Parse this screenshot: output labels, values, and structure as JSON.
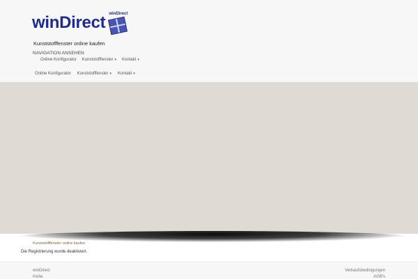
{
  "header": {
    "logo_text": "winDirect",
    "logo_badge_text": "winDirect",
    "tagline": "Kunststofffenster online kaufen",
    "nav_toggle": "NAVIGATION ANSEHEN"
  },
  "nav_primary": [
    {
      "label": "Online Konfigurator",
      "has_dropdown": false
    },
    {
      "label": "Kunststofffenster",
      "has_dropdown": true
    },
    {
      "label": "Kontakt",
      "has_dropdown": true
    }
  ],
  "nav_secondary": [
    {
      "label": "Online Konfigurator",
      "has_dropdown": false
    },
    {
      "label": "Kunststofffenster",
      "has_dropdown": true
    },
    {
      "label": "Kontakt",
      "has_dropdown": true
    }
  ],
  "content": {
    "breadcrumb": "Kunststofffenster online kaufen",
    "notice": "Die Registrierung wurde deaktiviert."
  },
  "footer": {
    "left_title": "winDirect",
    "left_sub": "Inolia",
    "right_link1": "Verkaufsbedingungen",
    "right_link2": "AGB's"
  },
  "colors": {
    "brand_blue": "#1f2a8a",
    "hero_bg": "#dedbd4",
    "header_bg": "#f7f7f7"
  }
}
